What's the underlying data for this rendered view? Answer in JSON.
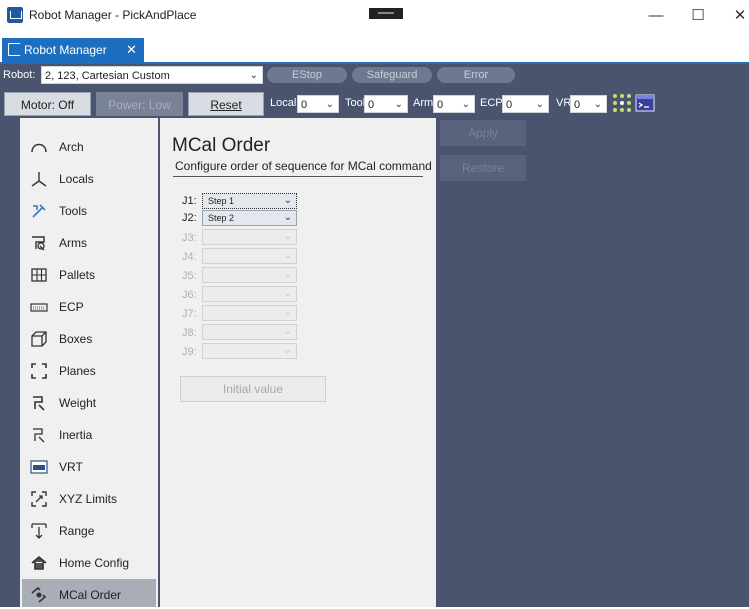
{
  "window": {
    "title": "Robot Manager - PickAndPlace",
    "minimize": "—",
    "maximize": "☐",
    "close": "✕"
  },
  "tab": {
    "label": "Robot Manager",
    "close": "✕"
  },
  "toolbar": {
    "robot_label": "Robot:",
    "robot_value": "2, 123, Cartesian Custom",
    "estop": "EStop",
    "safeguard": "Safeguard",
    "error": "Error",
    "motor": "Motor: Off",
    "power": "Power: Low",
    "reset": "Reset",
    "local_label": "Local:",
    "local_value": "0",
    "tool_label": "Tool:",
    "tool_value": "0",
    "arm_label": "Arm:",
    "arm_value": "0",
    "ecp_label": "ECP:",
    "ecp_value": "0",
    "vrt_label": "VRT:",
    "vrt_value": "0"
  },
  "sidebar": {
    "items": [
      {
        "label": "Arch",
        "icon": "arch-icon"
      },
      {
        "label": "Locals",
        "icon": "locals-icon"
      },
      {
        "label": "Tools",
        "icon": "tools-icon"
      },
      {
        "label": "Arms",
        "icon": "arms-icon"
      },
      {
        "label": "Pallets",
        "icon": "pallets-icon"
      },
      {
        "label": "ECP",
        "icon": "ecp-icon"
      },
      {
        "label": "Boxes",
        "icon": "boxes-icon"
      },
      {
        "label": "Planes",
        "icon": "planes-icon"
      },
      {
        "label": "Weight",
        "icon": "weight-icon"
      },
      {
        "label": "Inertia",
        "icon": "inertia-icon"
      },
      {
        "label": "VRT",
        "icon": "vrt-icon"
      },
      {
        "label": "XYZ Limits",
        "icon": "xyz-limits-icon"
      },
      {
        "label": "Range",
        "icon": "range-icon"
      },
      {
        "label": "Home Config",
        "icon": "home-config-icon"
      },
      {
        "label": "MCal Order",
        "icon": "mcal-order-icon"
      }
    ],
    "active": "MCal Order"
  },
  "main": {
    "title": "MCal Order",
    "subtitle": "Configure order of sequence for MCal command",
    "joints": [
      {
        "label": "J1:",
        "value": "Step 1"
      },
      {
        "label": "J2:",
        "value": "Step 2"
      },
      {
        "label": "J3:",
        "value": ""
      },
      {
        "label": "J4:",
        "value": ""
      },
      {
        "label": "J5:",
        "value": ""
      },
      {
        "label": "J6:",
        "value": ""
      },
      {
        "label": "J7:",
        "value": ""
      },
      {
        "label": "J8:",
        "value": ""
      },
      {
        "label": "J9:",
        "value": ""
      }
    ],
    "initial_value": "Initial value"
  },
  "actions": {
    "apply": "Apply",
    "restore": "Restore"
  },
  "colors": {
    "toolbar_bg": "#4a546e",
    "accent": "#1e6ec0",
    "panel_bg": "#f0f0f0",
    "active_item": "#a8adb6"
  }
}
